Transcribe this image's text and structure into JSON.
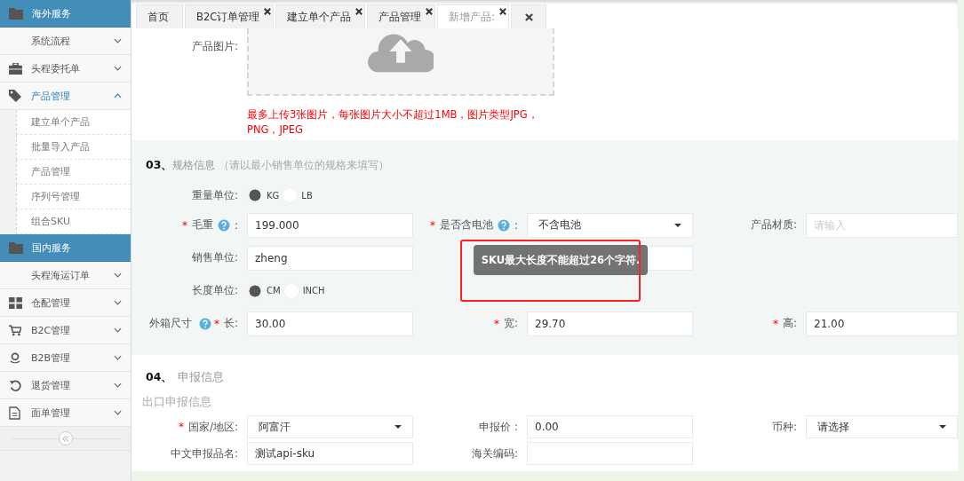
{
  "sidebar": {
    "items": [
      {
        "kind": "group",
        "label": "海外服务"
      },
      {
        "kind": "menu",
        "label": "系统流程",
        "expanded": false
      },
      {
        "kind": "menu",
        "label": "头程委托单",
        "expanded": false
      },
      {
        "kind": "menu",
        "label": "产品管理",
        "expanded": true,
        "children": [
          {
            "label": "建立单个产品"
          },
          {
            "label": "批量导入产品"
          },
          {
            "label": "产品管理"
          },
          {
            "label": "序列号管理"
          },
          {
            "label": "组合SKU"
          }
        ]
      },
      {
        "kind": "group",
        "label": "国内服务"
      },
      {
        "kind": "menu",
        "label": "头程海运订单",
        "expanded": false
      },
      {
        "kind": "menu",
        "label": "仓配管理",
        "expanded": false
      },
      {
        "kind": "menu",
        "label": "B2C管理",
        "expanded": false
      },
      {
        "kind": "menu",
        "label": "B2B管理",
        "expanded": false
      },
      {
        "kind": "menu",
        "label": "退货管理",
        "expanded": false
      },
      {
        "kind": "menu",
        "label": "面单管理",
        "expanded": false
      }
    ],
    "collapse_button": true
  },
  "tabs": [
    {
      "label": "首页",
      "closable": false,
      "selected": false
    },
    {
      "label": "B2C订单管理",
      "closable": true,
      "selected": false
    },
    {
      "label": "建立单个产品",
      "closable": true,
      "selected": false
    },
    {
      "label": "产品管理",
      "closable": true,
      "selected": false
    },
    {
      "label": "新增产品:",
      "closable": true,
      "selected": true
    }
  ],
  "close_all_tab": true,
  "upload": {
    "label": "产品图片:",
    "note": "最多上传3张图片，每张图片大小不超过1MB，图片类型JPG，PNG，JPEG"
  },
  "spec_section": {
    "number": "03、",
    "title": "规格信息",
    "hint": "（请以最小销售单位的规格来填写）",
    "rows": [
      {
        "kind": "radio",
        "label": "重量单位:",
        "options": [
          {
            "label": "KG",
            "selected": true
          },
          {
            "label": "LB",
            "selected": false
          }
        ]
      },
      {
        "kind": "fields",
        "fields": [
          {
            "kind": "input",
            "required_mark": "*",
            "label": "毛重",
            "help": true,
            "colon": ":",
            "value": "199.000"
          },
          {
            "kind": "select",
            "required_mark": "*",
            "label": "是否含电池",
            "help": true,
            "colon": ":",
            "value": "不含电池"
          },
          {
            "kind": "input",
            "label": "产品材质:",
            "placeholder": "请输入"
          }
        ]
      },
      {
        "kind": "fields",
        "fields": [
          {
            "kind": "input",
            "label": "销售单位:",
            "value": "zheng"
          },
          {
            "kind": "input"
          }
        ]
      },
      {
        "kind": "radio",
        "label": "长度单位:",
        "options": [
          {
            "label": "CM",
            "selected": true
          },
          {
            "label": "INCH",
            "selected": false
          }
        ]
      },
      {
        "kind": "fields",
        "lead": "外箱尺寸",
        "lead_help": true,
        "fields": [
          {
            "kind": "input",
            "required_mark": "*",
            "label": "长:",
            "value": "30.00"
          },
          {
            "kind": "input",
            "required_mark": "*",
            "label": "宽:",
            "value": "29.70"
          },
          {
            "kind": "input",
            "required_mark": "*",
            "label": "高:",
            "value": "21.00"
          }
        ]
      }
    ]
  },
  "declare_section": {
    "number": "04、",
    "title": "申报信息",
    "subtitle": "出口申报信息",
    "rows": [
      {
        "kind": "fields",
        "fields": [
          {
            "kind": "select",
            "required_mark": "*",
            "label": "国家/地区:",
            "value": "阿富汗"
          },
          {
            "kind": "input",
            "label": "申报价 :",
            "value": "0.00"
          },
          {
            "kind": "select",
            "label": "币种:",
            "value": "请选择"
          }
        ]
      },
      {
        "kind": "fields",
        "fields": [
          {
            "kind": "input",
            "label": "中文申报品名:",
            "value": "测试api-sku"
          },
          {
            "kind": "input",
            "label": "海关编码:"
          }
        ]
      }
    ]
  },
  "toast": {
    "text": "SKU最大长度不能超过26个字符.",
    "highlighted": true
  }
}
